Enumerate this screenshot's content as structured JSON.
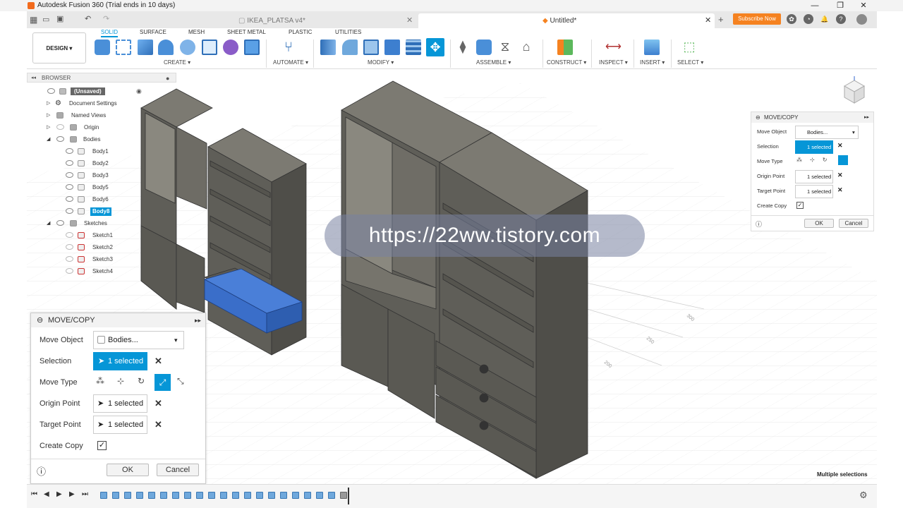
{
  "window": {
    "title": "Autodesk Fusion 360 (Trial ends in 10 days)",
    "min": "—",
    "max": "❐",
    "close": "✕"
  },
  "tabs": [
    {
      "label": "IKEA_PLATSA v4*"
    },
    {
      "label": "Untitled*"
    }
  ],
  "header": {
    "subscribe": "Subscribe Now"
  },
  "toolbar": {
    "design": "DESIGN",
    "workspace_tabs": [
      "SOLID",
      "SURFACE",
      "MESH",
      "SHEET METAL",
      "PLASTIC",
      "UTILITIES"
    ],
    "groups": [
      "CREATE",
      "AUTOMATE",
      "MODIFY",
      "ASSEMBLE",
      "CONSTRUCT",
      "INSPECT",
      "INSERT",
      "SELECT"
    ]
  },
  "browser": {
    "title": "BROWSER",
    "rows": [
      {
        "label": "(Unsaved)"
      },
      {
        "label": "Document Settings"
      },
      {
        "label": "Named Views"
      },
      {
        "label": "Origin"
      },
      {
        "label": "Bodies"
      },
      {
        "label": "Body1"
      },
      {
        "label": "Body2"
      },
      {
        "label": "Body3"
      },
      {
        "label": "Body5"
      },
      {
        "label": "Body6"
      },
      {
        "label": "Body8"
      },
      {
        "label": "Sketches"
      },
      {
        "label": "Sketch1"
      },
      {
        "label": "Sketch2"
      },
      {
        "label": "Sketch3"
      },
      {
        "label": "Sketch4"
      }
    ]
  },
  "move_copy": {
    "title": "MOVE/COPY",
    "move_object_label": "Move Object",
    "move_object_value": "Bodies...",
    "selection_label": "Selection",
    "selection_value": "1 selected",
    "move_type_label": "Move Type",
    "origin_label": "Origin Point",
    "origin_value": "1 selected",
    "target_label": "Target Point",
    "target_value": "1 selected",
    "create_copy_label": "Create Copy",
    "create_copy_checked": true,
    "ok": "OK",
    "cancel": "Cancel"
  },
  "viewport": {
    "watermark": "https://22ww.tistory.com",
    "status": "Multiple selections",
    "grid_labels": [
      "300",
      "250",
      "200"
    ]
  },
  "colors": {
    "accent": "#0696d7",
    "subscribe": "#f58220",
    "cabinet": "#6b6a63",
    "selected_body": "#3a6ec9"
  }
}
